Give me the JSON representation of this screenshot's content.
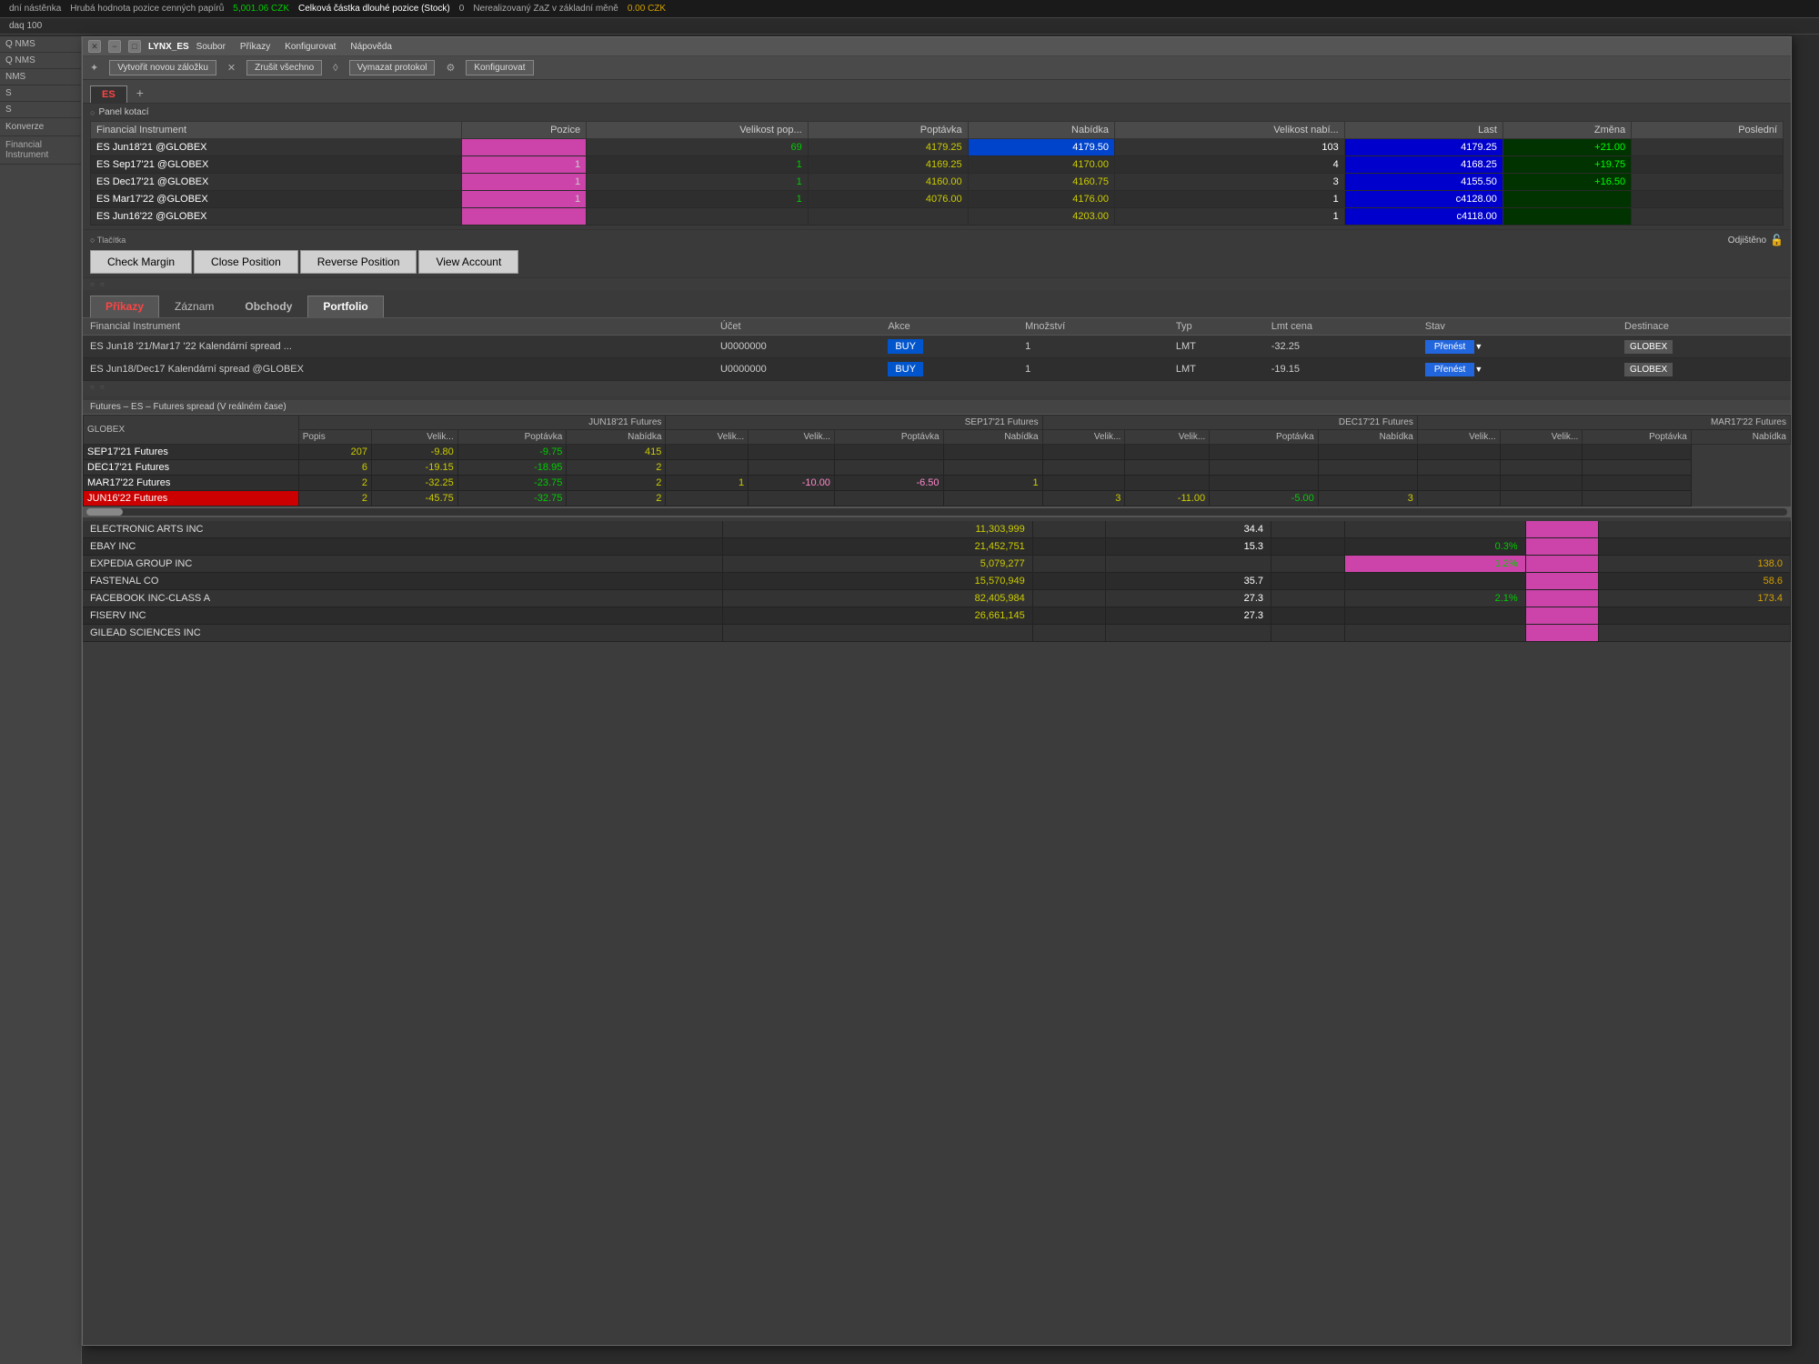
{
  "topbar": {
    "text1": "dní nástěnka",
    "text2": "Hrubá hodnota pozice cenných papírů",
    "val1": "5,001.06 CZK",
    "val2": "0.00 CZK",
    "text3": "Celková částka dlouhé pozice (Stock)",
    "val3": "0",
    "text4": "Nerealizovaný ZaZ v základní měně",
    "val4": "0.00 CZK"
  },
  "secbar": {
    "text": "daq 100"
  },
  "window": {
    "title": "LYNX_ES",
    "menu": [
      "Soubor",
      "Příkazy",
      "Konfigurovat",
      "Nápověda"
    ],
    "toolbar": [
      {
        "icon": "✦",
        "label": "Vytvořit novou záložku"
      },
      {
        "icon": "✕",
        "label": "Zrušit všechno"
      },
      {
        "icon": "◊",
        "label": "Vymazat protokol"
      },
      {
        "icon": "⚙",
        "label": "Konfigurovat"
      }
    ]
  },
  "tab": {
    "name": "ES",
    "plus": "+"
  },
  "panelKotaci": {
    "title": "Panel kotací",
    "headers": [
      "Financial Instrument",
      "Pozice",
      "Velikost pop...",
      "Poptávka",
      "Nabídka",
      "Velikost nabí...",
      "Last",
      "Změna",
      "Poslední"
    ],
    "rows": [
      {
        "instrument": "ES Jun18'21 @GLOBEX",
        "pozice": "",
        "velPop": "69",
        "poptavka": "4179.25",
        "nabidka": "4179.50",
        "velNab": "103",
        "last": "4179.25",
        "zmena": "+21.00",
        "posledni": ""
      },
      {
        "instrument": "ES Sep17'21 @GLOBEX",
        "pozice": "1",
        "velPop": "1",
        "poptavka": "4169.25",
        "nabidka": "4170.00",
        "velNab": "4",
        "last": "4168.25",
        "zmena": "+19.75",
        "posledni": ""
      },
      {
        "instrument": "ES Dec17'21 @GLOBEX",
        "pozice": "1",
        "velPop": "1",
        "poptavka": "4160.00",
        "nabidka": "4160.75",
        "velNab": "3",
        "last": "4155.50",
        "zmena": "+16.50",
        "posledni": ""
      },
      {
        "instrument": "ES Mar17'22 @GLOBEX",
        "pozice": "1",
        "velPop": "1",
        "poptavka": "4076.00",
        "nabidka": "4176.00",
        "velNab": "1",
        "last": "c4128.00",
        "zmena": "",
        "posledni": ""
      },
      {
        "instrument": "ES Jun16'22 @GLOBEX",
        "pozice": "",
        "velPop": "",
        "poptavka": "",
        "nabidka": "4203.00",
        "velNab": "1",
        "last": "c4118.00",
        "zmena": "",
        "posledni": ""
      }
    ]
  },
  "buttons": {
    "title": "Tlačítka",
    "odjisteno": "Odjištěno",
    "list": [
      "Check Margin",
      "Close Position",
      "Reverse Position",
      "View Account"
    ]
  },
  "ordersTabs": [
    "Příkazy",
    "Záznam",
    "Obchody",
    "Portfolio"
  ],
  "ordersHeaders": [
    "Financial Instrument",
    "Účet",
    "Akce",
    "Množství",
    "Typ",
    "Lmt cena",
    "Stav",
    "Destinace"
  ],
  "ordersRows": [
    {
      "instrument": "ES Jun18 '21/Mar17 '22 Kalendární spread ...",
      "ucet": "U0000000",
      "akce": "BUY",
      "mnozstvi": "1",
      "typ": "LMT",
      "lmtCena": "-32.25",
      "stav": "Přenést",
      "destinace": "GLOBEX"
    },
    {
      "instrument": "ES Jun18/Dec17 Kalendární spread @GLOBEX",
      "ucet": "U0000000",
      "akce": "BUY",
      "mnozstvi": "1",
      "typ": "LMT",
      "lmtCena": "-19.15",
      "stav": "Přenést",
      "destinace": "GLOBEX"
    }
  ],
  "futuresSection": {
    "title": "Futures – ES – Futures spread (V reálném čase)",
    "exchange": "GLOBEX",
    "colGroups": [
      "JUN18'21 Futures",
      "SEP17'21 Futures",
      "DEC17'21 Futures",
      "MAR17'22 Futures"
    ],
    "subHeaders": [
      "Popis",
      "Velik...",
      "Poptávka",
      "Nabídka",
      "Velik...",
      "Velik...",
      "Poptávka",
      "Nabídka",
      "Velik...",
      "Velik...",
      "Poptávka",
      "Nabídka",
      "Velik...",
      "Velik...",
      "Poptávka",
      "Nabídka"
    ],
    "rows": [
      {
        "popis": "SEP17'21 Futures",
        "v1": "207",
        "p1": "-9.80",
        "n1": "-9.75",
        "vv1": "415",
        "v2": "",
        "p2": "",
        "n2": "",
        "vv2": "",
        "v3": "",
        "p3": "",
        "n3": "",
        "vv3": "",
        "v4": "",
        "p4": "",
        "n4": "",
        "highlight": false
      },
      {
        "popis": "DEC17'21 Futures",
        "v1": "6",
        "p1": "-19.15",
        "n1": "-18.95",
        "vv1": "2",
        "v2": "",
        "p2": "",
        "n2": "",
        "vv2": "",
        "v3": "",
        "p3": "",
        "n3": "",
        "vv3": "",
        "v4": "",
        "p4": "",
        "n4": "",
        "highlight": false
      },
      {
        "popis": "MAR17'22 Futures",
        "v1": "2",
        "p1": "-32.25",
        "n1": "-23.75",
        "vv1": "2",
        "v2": "1",
        "p2": "-10.00",
        "n2": "-6.50",
        "vv2": "1",
        "v3": "",
        "p3": "",
        "n3": "",
        "vv3": "",
        "v4": "",
        "p4": "",
        "n4": "",
        "highlight": false
      },
      {
        "popis": "JUN16'22 Futures",
        "v1": "2",
        "p1": "-45.75",
        "n1": "-32.75",
        "vv1": "2",
        "v2": "",
        "p2": "",
        "n2": "",
        "vv2": "",
        "v3": "3",
        "p3": "-11.00",
        "n3": "-5.00",
        "vv3": "3",
        "v4": "",
        "p4": "",
        "n4": "",
        "highlight": true
      }
    ]
  },
  "stockTable": {
    "rows": [
      {
        "name": "ELECTRONIC ARTS INC",
        "v1": "11,303,999",
        "v2": "",
        "v3": "34.4",
        "v4": "",
        "v5": "",
        "v6": "",
        "v7": ""
      },
      {
        "name": "EBAY INC",
        "v1": "21,452,751",
        "v2": "",
        "v3": "15.3",
        "v4": "",
        "v5": "0.3%",
        "v6": "",
        "v7": ""
      },
      {
        "name": "EXPEDIA GROUP INC",
        "v1": "5,079,277",
        "v2": "",
        "v3": "",
        "v4": "",
        "v5": "1.2%",
        "v6": "",
        "v7": "138.0"
      },
      {
        "name": "FASTENAL CO",
        "v1": "15,570,949",
        "v2": "",
        "v3": "35.7",
        "v4": "",
        "v5": "",
        "v6": "",
        "v7": "58.6"
      },
      {
        "name": "FACEBOOK INC-CLASS A",
        "v1": "82,405,984",
        "v2": "",
        "v3": "27.3",
        "v4": "",
        "v5": "2.1%",
        "v6": "",
        "v7": "173.4"
      },
      {
        "name": "FISERV INC",
        "v1": "26,661,145",
        "v2": "",
        "v3": "27.3",
        "v4": "",
        "v5": "",
        "v6": "",
        "v7": ""
      },
      {
        "name": "GILEAD SCIENCES INC",
        "v1": "",
        "v2": "",
        "v3": "",
        "v4": "",
        "v5": "",
        "v6": "",
        "v7": ""
      }
    ]
  },
  "sidebar": {
    "items": [
      "Q NMS",
      "Q NMS",
      "NMS",
      "S",
      "S"
    ]
  }
}
